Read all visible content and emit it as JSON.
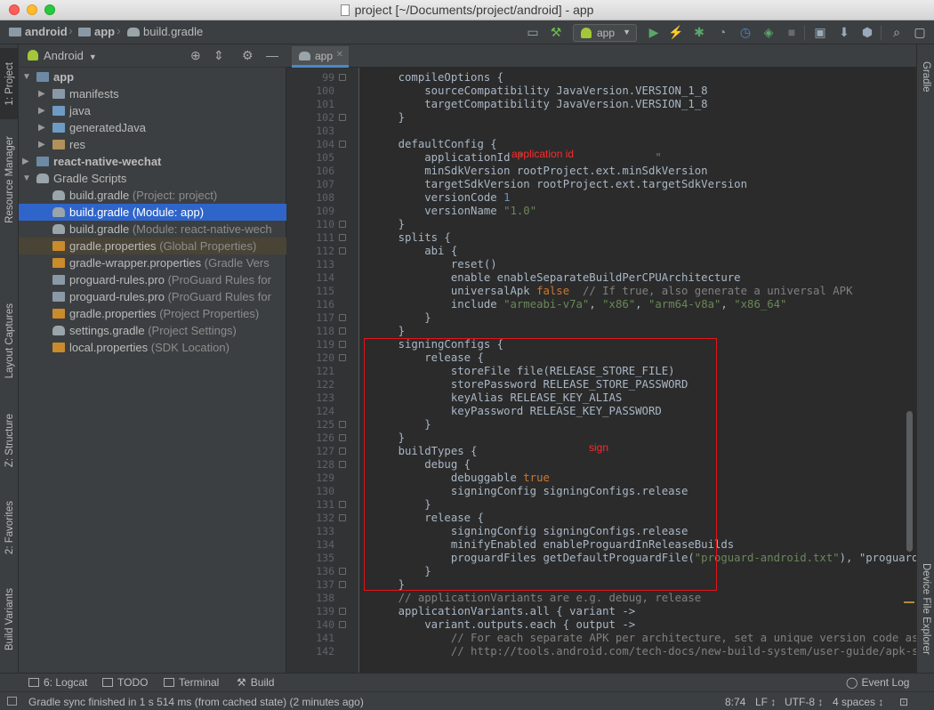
{
  "window": {
    "title": "project [~/Documents/project/android] - app"
  },
  "breadcrumbs": [
    "android",
    "app",
    "build.gradle"
  ],
  "toolbar": {
    "run_config": "app"
  },
  "left_stripe": [
    "1: Project",
    "Resource Manager",
    "Layout Captures",
    "Z: Structure",
    "2: Favorites",
    "Build Variants"
  ],
  "right_stripe": [
    "Gradle",
    "Device File Explorer"
  ],
  "project_panel": {
    "view": "Android",
    "tree": [
      {
        "label": "app",
        "extra": ""
      },
      {
        "label": "manifests",
        "extra": ""
      },
      {
        "label": "java",
        "extra": ""
      },
      {
        "label": "generatedJava",
        "extra": ""
      },
      {
        "label": "res",
        "extra": ""
      },
      {
        "label": "react-native-wechat",
        "extra": ""
      },
      {
        "label": "Gradle Scripts",
        "extra": ""
      },
      {
        "label": "build.gradle",
        "extra": "(Project: project)"
      },
      {
        "label": "build.gradle",
        "extra": "(Module: app)"
      },
      {
        "label": "build.gradle",
        "extra": "(Module: react-native-wech"
      },
      {
        "label": "gradle.properties",
        "extra": "(Global Properties)"
      },
      {
        "label": "gradle-wrapper.properties",
        "extra": "(Gradle Vers"
      },
      {
        "label": "proguard-rules.pro",
        "extra": "(ProGuard Rules for"
      },
      {
        "label": "proguard-rules.pro",
        "extra": "(ProGuard Rules for"
      },
      {
        "label": "gradle.properties",
        "extra": "(Project Properties)"
      },
      {
        "label": "settings.gradle",
        "extra": "(Project Settings)"
      },
      {
        "label": "local.properties",
        "extra": "(SDK Location)"
      }
    ]
  },
  "editor": {
    "tab": "app",
    "annotations": {
      "application_id": "application id",
      "sign": "sign"
    },
    "lines": [
      {
        "n": "99",
        "t": "    compileOptions {"
      },
      {
        "n": "100",
        "t": "        sourceCompatibility JavaVersion.VERSION_1_8"
      },
      {
        "n": "101",
        "t": "        targetCompatibility JavaVersion.VERSION_1_8"
      },
      {
        "n": "102",
        "t": "    }"
      },
      {
        "n": "103",
        "t": ""
      },
      {
        "n": "104",
        "t": "    defaultConfig {"
      },
      {
        "n": "105",
        "t": "        applicationId \"                    \""
      },
      {
        "n": "106",
        "t": "        minSdkVersion rootProject.ext.minSdkVersion"
      },
      {
        "n": "107",
        "t": "        targetSdkVersion rootProject.ext.targetSdkVersion"
      },
      {
        "n": "108",
        "t": "        versionCode 1"
      },
      {
        "n": "109",
        "t": "        versionName \"1.0\""
      },
      {
        "n": "110",
        "t": "    }"
      },
      {
        "n": "111",
        "t": "    splits {"
      },
      {
        "n": "112",
        "t": "        abi {"
      },
      {
        "n": "113",
        "t": "            reset()"
      },
      {
        "n": "114",
        "t": "            enable enableSeparateBuildPerCPUArchitecture"
      },
      {
        "n": "115",
        "t": "            universalApk false  // If true, also generate a universal APK"
      },
      {
        "n": "116",
        "t": "            include \"armeabi-v7a\", \"x86\", \"arm64-v8a\", \"x86_64\""
      },
      {
        "n": "117",
        "t": "        }"
      },
      {
        "n": "118",
        "t": "    }"
      },
      {
        "n": "119",
        "t": "    signingConfigs {"
      },
      {
        "n": "120",
        "t": "        release {"
      },
      {
        "n": "121",
        "t": "            storeFile file(RELEASE_STORE_FILE)"
      },
      {
        "n": "122",
        "t": "            storePassword RELEASE_STORE_PASSWORD"
      },
      {
        "n": "123",
        "t": "            keyAlias RELEASE_KEY_ALIAS"
      },
      {
        "n": "124",
        "t": "            keyPassword RELEASE_KEY_PASSWORD"
      },
      {
        "n": "125",
        "t": "        }"
      },
      {
        "n": "126",
        "t": "    }"
      },
      {
        "n": "127",
        "t": "    buildTypes {"
      },
      {
        "n": "128",
        "t": "        debug {"
      },
      {
        "n": "129",
        "t": "            debuggable true"
      },
      {
        "n": "130",
        "t": "            signingConfig signingConfigs.release"
      },
      {
        "n": "131",
        "t": "        }"
      },
      {
        "n": "132",
        "t": "        release {"
      },
      {
        "n": "133",
        "t": "            signingConfig signingConfigs.release"
      },
      {
        "n": "134",
        "t": "            minifyEnabled enableProguardInReleaseBuilds"
      },
      {
        "n": "135",
        "t": "            proguardFiles getDefaultProguardFile(\"proguard-android.txt\"), \"proguard-rules.p"
      },
      {
        "n": "136",
        "t": "        }"
      },
      {
        "n": "137",
        "t": "    }"
      },
      {
        "n": "138",
        "t": "    // applicationVariants are e.g. debug, release"
      },
      {
        "n": "139",
        "t": "    applicationVariants.all { variant ->"
      },
      {
        "n": "140",
        "t": "        variant.outputs.each { output ->"
      },
      {
        "n": "141",
        "t": "            // For each separate APK per architecture, set a unique version code as describe"
      },
      {
        "n": "142",
        "t": "            // http://tools.android.com/tech-docs/new-build-system/user-guide/apk-splits"
      }
    ]
  },
  "bottom_tools": {
    "logcat": "6: Logcat",
    "todo": "TODO",
    "terminal": "Terminal",
    "build": "Build",
    "event_log": "Event Log"
  },
  "status": {
    "message": "Gradle sync finished in 1 s 514 ms (from cached state) (2 minutes ago)",
    "position": "8:74",
    "line_sep": "LF ↕",
    "encoding": "UTF-8 ↕",
    "indent": "4 spaces ↕"
  }
}
